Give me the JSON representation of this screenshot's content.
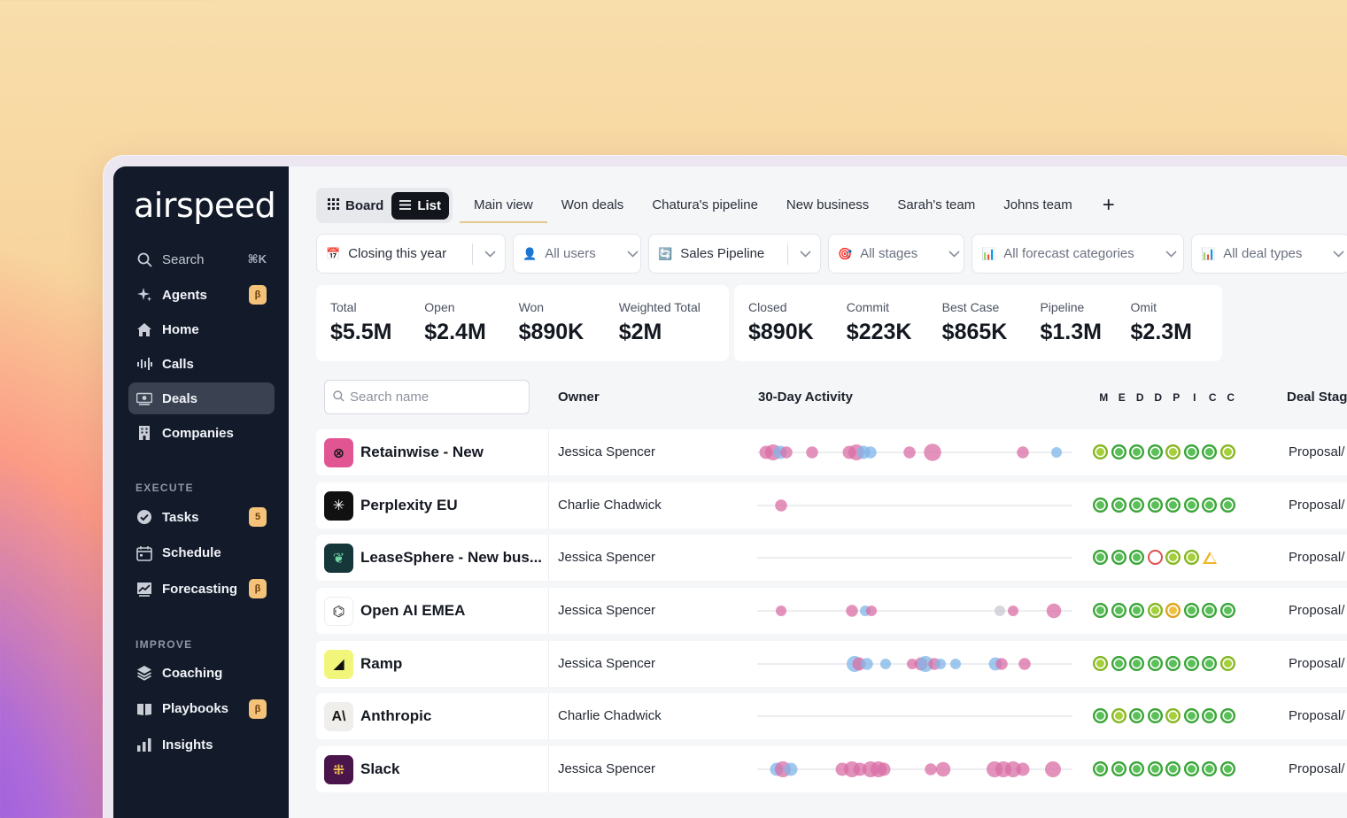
{
  "sidebar": {
    "logo": "airspeed",
    "search_label": "Search",
    "search_shortcut": "⌘K",
    "items_top": [
      {
        "label": "Agents",
        "badge": "β",
        "icon": "sparkle-icon"
      },
      {
        "label": "Home",
        "badge": "",
        "icon": "home-icon"
      },
      {
        "label": "Calls",
        "badge": "",
        "icon": "waveform-icon"
      },
      {
        "label": "Deals",
        "badge": "",
        "icon": "money-icon",
        "active": true
      },
      {
        "label": "Companies",
        "badge": "",
        "icon": "building-icon"
      }
    ],
    "section_execute": "EXECUTE",
    "items_execute": [
      {
        "label": "Tasks",
        "badge": "5",
        "icon": "check-badge-icon"
      },
      {
        "label": "Schedule",
        "badge": "",
        "icon": "calendar-icon"
      },
      {
        "label": "Forecasting",
        "badge": "β",
        "icon": "trend-chart-icon"
      }
    ],
    "section_improve": "IMPROVE",
    "items_improve": [
      {
        "label": "Coaching",
        "badge": "",
        "icon": "layers-icon"
      },
      {
        "label": "Playbooks",
        "badge": "β",
        "icon": "book-icon"
      },
      {
        "label": "Insights",
        "badge": "",
        "icon": "bar-chart-icon"
      }
    ]
  },
  "toolbar": {
    "board_label": "Board",
    "list_label": "List",
    "views": [
      "Main view",
      "Won deals",
      "Chatura's pipeline",
      "New business",
      "Sarah's team",
      "Johns team"
    ],
    "add_label": "+"
  },
  "filters": [
    {
      "label": "Closing this year",
      "icon": "📅"
    },
    {
      "label": "All users",
      "icon": "👤"
    },
    {
      "label": "Sales Pipeline",
      "icon": "🔄"
    },
    {
      "label": "All stages",
      "icon": "🎯"
    },
    {
      "label": "All forecast categories",
      "icon": "📊"
    },
    {
      "label": "All deal types",
      "icon": "📊"
    }
  ],
  "stats_left": [
    {
      "label": "Total",
      "value": "$5.5M"
    },
    {
      "label": "Open",
      "value": "$2.4M"
    },
    {
      "label": "Won",
      "value": "$890K"
    },
    {
      "label": "Weighted Total",
      "value": "$2M"
    }
  ],
  "stats_right": [
    {
      "label": "Closed",
      "value": "$890K"
    },
    {
      "label": "Commit",
      "value": "$223K"
    },
    {
      "label": "Best Case",
      "value": "$865K"
    },
    {
      "label": "Pipeline",
      "value": "$1.3M"
    },
    {
      "label": "Omit",
      "value": "$2.3M"
    }
  ],
  "table": {
    "search_placeholder": "Search name",
    "col_owner": "Owner",
    "col_activity": "30-Day Activity",
    "meddpicc_letters": [
      "M",
      "E",
      "D",
      "D",
      "P",
      "I",
      "C",
      "C"
    ],
    "col_stage": "Deal Stag",
    "rows": [
      {
        "name": "Retainwise - New",
        "owner": "Jessica Spencer",
        "stage": "Proposal/",
        "logo_color": "#e25593",
        "logo_text": "⊗",
        "logo_fg": "#1a1a1a",
        "meddpicc": [
          "y",
          "g",
          "g",
          "g",
          "y",
          "g",
          "g",
          "y"
        ],
        "activity": [
          [
            10,
            10,
            "p"
          ],
          [
            18,
            12,
            "p"
          ],
          [
            26,
            10,
            "b"
          ],
          [
            33,
            9,
            "p"
          ],
          [
            62,
            9,
            "p"
          ],
          [
            104,
            10,
            "p"
          ],
          [
            112,
            12,
            "p"
          ],
          [
            120,
            10,
            "b"
          ],
          [
            128,
            9,
            "b"
          ],
          [
            172,
            9,
            "p"
          ],
          [
            198,
            13,
            "p"
          ],
          [
            300,
            9,
            "p"
          ],
          [
            338,
            8,
            "b"
          ]
        ]
      },
      {
        "name": "Perplexity EU",
        "owner": "Charlie Chadwick",
        "stage": "Proposal/",
        "logo_color": "#111111",
        "logo_text": "✳",
        "logo_fg": "#ffffff",
        "meddpicc": [
          "g",
          "g",
          "g",
          "g",
          "g",
          "g",
          "g",
          "g"
        ],
        "activity": [
          [
            27,
            9,
            "p"
          ]
        ]
      },
      {
        "name": "LeaseSphere - New bus...",
        "owner": "Jessica Spencer",
        "stage": "Proposal/",
        "logo_color": "#15373a",
        "logo_text": "❦",
        "logo_fg": "#6fd3a3",
        "meddpicc": [
          "g",
          "g",
          "g",
          "r",
          "y",
          "y",
          "w"
        ],
        "activity": []
      },
      {
        "name": "Open AI EMEA",
        "owner": "Jessica Spencer",
        "stage": "Proposal/",
        "logo_color": "#ffffff",
        "logo_text": "⌬",
        "logo_fg": "#222222",
        "meddpicc": [
          "g",
          "g",
          "g",
          "y",
          "o",
          "g",
          "g",
          "g"
        ],
        "activity": [
          [
            27,
            8,
            "p"
          ],
          [
            107,
            9,
            "p"
          ],
          [
            122,
            8,
            "b"
          ],
          [
            129,
            8,
            "p"
          ],
          [
            274,
            8,
            "g"
          ],
          [
            289,
            8,
            "p"
          ],
          [
            335,
            11,
            "p"
          ]
        ]
      },
      {
        "name": "Ramp",
        "owner": "Jessica Spencer",
        "stage": "Proposal/",
        "logo_color": "#f1f67a",
        "logo_text": "◢",
        "logo_fg": "#111111",
        "meddpicc": [
          "y",
          "g",
          "g",
          "g",
          "g",
          "g",
          "g",
          "y"
        ],
        "activity": [
          [
            110,
            12,
            "b"
          ],
          [
            115,
            10,
            "p"
          ],
          [
            124,
            9,
            "b"
          ],
          [
            145,
            8,
            "b"
          ],
          [
            175,
            8,
            "p"
          ],
          [
            185,
            10,
            "p"
          ],
          [
            190,
            12,
            "b"
          ],
          [
            200,
            9,
            "p"
          ],
          [
            207,
            8,
            "b"
          ],
          [
            224,
            8,
            "b"
          ],
          [
            269,
            10,
            "b"
          ],
          [
            276,
            9,
            "p"
          ],
          [
            302,
            9,
            "p"
          ]
        ]
      },
      {
        "name": "Anthropic",
        "owner": "Charlie Chadwick",
        "stage": "Proposal/",
        "logo_color": "#f0eeea",
        "logo_text": "A\\",
        "logo_fg": "#1a1a1a",
        "meddpicc": [
          "g",
          "y",
          "g",
          "g",
          "y",
          "g",
          "g",
          "g"
        ],
        "activity": []
      },
      {
        "name": "Slack",
        "owner": "Jessica Spencer",
        "stage": "Proposal/",
        "logo_color": "#4a154b",
        "logo_text": "⁜",
        "logo_fg": "#f2c14e",
        "meddpicc": [
          "g",
          "g",
          "g",
          "g",
          "g",
          "g",
          "g",
          "g"
        ],
        "activity": [
          [
            22,
            10,
            "b"
          ],
          [
            29,
            12,
            "p"
          ],
          [
            38,
            10,
            "b"
          ],
          [
            96,
            10,
            "p"
          ],
          [
            107,
            12,
            "p"
          ],
          [
            116,
            10,
            "p"
          ],
          [
            128,
            12,
            "p"
          ],
          [
            137,
            12,
            "p"
          ],
          [
            143,
            10,
            "p"
          ],
          [
            196,
            9,
            "p"
          ],
          [
            210,
            11,
            "p"
          ],
          [
            268,
            12,
            "p"
          ],
          [
            278,
            12,
            "p"
          ],
          [
            289,
            12,
            "p"
          ],
          [
            300,
            10,
            "p"
          ],
          [
            334,
            12,
            "p"
          ]
        ]
      }
    ]
  },
  "colors": {
    "activity_pink": "#d96ea5",
    "activity_blue": "#7fb6ea",
    "activity_gray": "#c8c9d0",
    "accent_underline": "#e3c88d"
  }
}
